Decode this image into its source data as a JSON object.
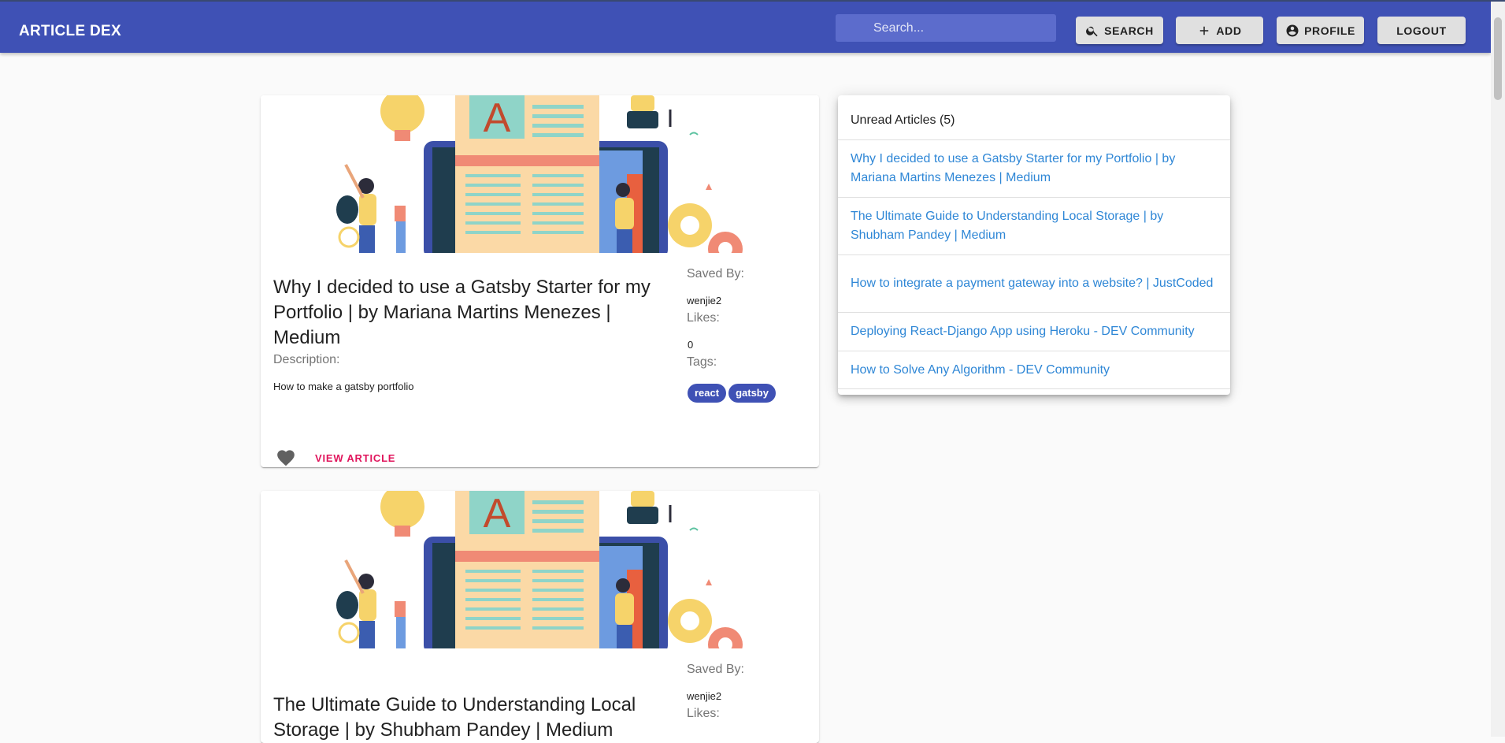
{
  "appbar": {
    "brand": "ARTICLE DEX",
    "search_placeholder": "Search...",
    "buttons": {
      "search": "SEARCH",
      "add": "ADD",
      "profile": "PROFILE",
      "logout": "LOGOUT"
    }
  },
  "labels": {
    "saved_by": "Saved By:",
    "likes": "Likes:",
    "tags": "Tags:",
    "description": "Description:",
    "view_article": "VIEW ARTICLE"
  },
  "articles": [
    {
      "title": "Why I decided to use a Gatsby Starter for my Portfolio | by Mariana Martins Menezes | Medium",
      "description": "How to make a gatsby portfolio",
      "saved_by": "wenjie2",
      "likes": "0",
      "tags": [
        "react",
        "gatsby"
      ]
    },
    {
      "title": "The Ultimate Guide to Understanding Local Storage | by Shubham Pandey | Medium",
      "saved_by": "wenjie2"
    }
  ],
  "unread": {
    "heading": "Unread Articles (5)",
    "items": [
      "Why I decided to use a Gatsby Starter for my Portfolio | by Mariana Martins Menezes | Medium",
      "The Ultimate Guide to Understanding Local Storage | by Shubham Pandey | Medium",
      "How to integrate a payment gateway into a website? | JustCoded",
      "Deploying React-Django App using Heroku - DEV Community",
      "How to Solve Any Algorithm - DEV Community"
    ]
  },
  "colors": {
    "primary": "#3f51b5",
    "accent": "#e0155c",
    "link": "#2f87d6",
    "icons": [
      "search-icon",
      "plus-icon",
      "account-circle-icon",
      "heart-icon"
    ]
  }
}
